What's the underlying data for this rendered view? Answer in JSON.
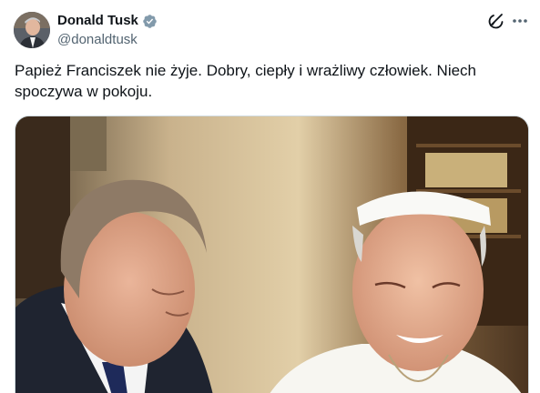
{
  "author": {
    "display_name": "Donald Tusk",
    "handle": "@donaldtusk",
    "verified": true
  },
  "actions": {
    "grok_icon": "grok-icon",
    "more_icon": "more-horizontal-icon"
  },
  "tweet": {
    "text": "Papież Franciszek nie żyje. Dobry, ciepły i wrażliwy człowiek. Niech spoczywa w pokoju."
  },
  "media": {
    "type": "photo"
  },
  "colors": {
    "text_primary": "#0f1419",
    "text_secondary": "#536471",
    "verified_badge": "#829aab",
    "border": "#cfd9de"
  }
}
